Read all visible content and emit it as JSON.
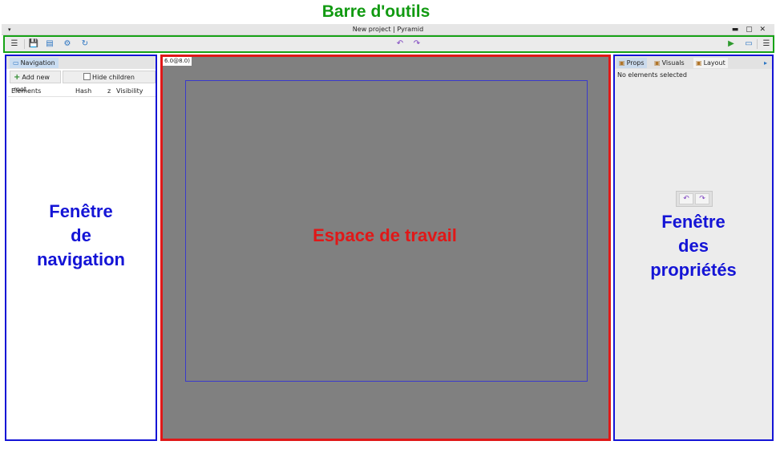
{
  "annotations": {
    "toolbar_label": "Barre d'outils",
    "navigation_label": [
      "Fenêtre",
      "de",
      "navigation"
    ],
    "workspace_label": "Espace de travail",
    "properties_label": [
      "Fenêtre",
      "des",
      "propriétés"
    ]
  },
  "window": {
    "title": "New project | Pyramid",
    "menu_arrow": "▾",
    "controls": "▬ ▢ ✕"
  },
  "toolbar": {
    "left_icons": [
      "menu-icon",
      "save-icon",
      "layers-icon",
      "settings-icon",
      "refresh-icon"
    ],
    "center_icons": [
      "undo-icon",
      "redo-icon"
    ],
    "right_icons": [
      "play-icon",
      "window-icon",
      "menu-icon"
    ],
    "glyphs": {
      "menu": "☰",
      "save": "💾",
      "layers": "▤",
      "settings": "⚙",
      "refresh": "↻",
      "undo": "↶",
      "redo": "↷",
      "play": "▶",
      "window": "▭"
    }
  },
  "navigation": {
    "tab_label": "Navigation",
    "add_root_label": "Add new root",
    "hide_children_label": "Hide children",
    "columns": [
      "Elements",
      "Hash",
      "z",
      "Visibility"
    ]
  },
  "workspace": {
    "coords": "6.0@8.0)"
  },
  "properties": {
    "tabs": [
      "Props",
      "Visuals",
      "Layout"
    ],
    "no_selection_text": "No elements selected"
  },
  "colors": {
    "toolbar_highlight": "#16a316",
    "nav_highlight": "#1414d6",
    "workspace_highlight": "#e01818",
    "props_highlight": "#1414d6",
    "workspace_bg": "#808080"
  }
}
